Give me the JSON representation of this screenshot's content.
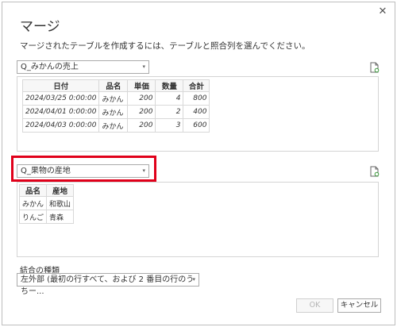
{
  "dialog": {
    "title": "マージ",
    "subtitle": "マージされたテーブルを作成するには、テーブルと照合列を選んでください。",
    "close": "✕"
  },
  "table1": {
    "selected": "Q_みかんの売上",
    "columns": [
      "日付",
      "品名",
      "単価",
      "数量",
      "合計"
    ],
    "rows": [
      [
        "2024/03/25 0:00:00",
        "みかん",
        "200",
        "4",
        "800"
      ],
      [
        "2024/04/01 0:00:00",
        "みかん",
        "200",
        "2",
        "400"
      ],
      [
        "2024/04/03 0:00:00",
        "みかん",
        "200",
        "3",
        "600"
      ]
    ]
  },
  "table2": {
    "selected": "Q_果物の産地",
    "columns": [
      "品名",
      "産地"
    ],
    "rows": [
      [
        "みかん",
        "和歌山"
      ],
      [
        "りんご",
        "青森"
      ]
    ]
  },
  "join": {
    "label": "結合の種類",
    "selected": "左外部 (最初の行すべて、および 2 番目の行のうちー..."
  },
  "buttons": {
    "ok": "OK",
    "cancel": "キャンセル"
  },
  "icons": {
    "dropdown": "▾",
    "file": "file-refresh-icon"
  },
  "colors": {
    "highlight": "#e0001a",
    "icon_accent": "#3a9a3a"
  }
}
